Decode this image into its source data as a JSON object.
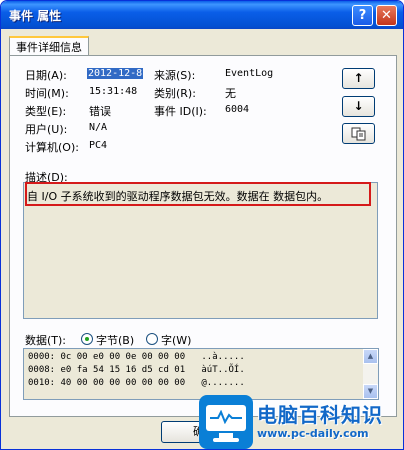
{
  "window": {
    "title": "事件 属性",
    "help_glyph": "?",
    "close_glyph": "✕"
  },
  "tabs": [
    {
      "label": "事件详细信息"
    }
  ],
  "fields": {
    "date_label": "日期(A):",
    "date_value": "2012-12-8",
    "source_label": "来源(S):",
    "source_value": "EventLog",
    "time_label": "时间(M):",
    "time_value": "15:31:48",
    "category_label": "类别(R):",
    "category_value": "无",
    "type_label": "类型(E):",
    "type_value": "错误",
    "event_id_label": "事件 ID(I):",
    "event_id_value": "6004",
    "user_label": "用户(U):",
    "user_value": "N/A",
    "computer_label": "计算机(O):",
    "computer_value": "PC4"
  },
  "nav": {
    "up_glyph": "↑",
    "down_glyph": "↓",
    "copy_icon": "copy-icon"
  },
  "description": {
    "label": "描述(D):",
    "text": "自 I/O 子系统收到的驱动程序数据包无效。数据在 数据包内。"
  },
  "data": {
    "label": "数据(T):",
    "bytes_label": "字节(B)",
    "words_label": "字(W)",
    "selected": "bytes",
    "rows": [
      "0000: 0c 00 e0 00 0e 00 00 00   ..à.....",
      "0008: e0 fa 54 15 16 d5 cd 01   àúT..ÕÍ.",
      "0010: 40 00 00 00 00 00 00 00   @......."
    ]
  },
  "buttons": {
    "ok_label": "确"
  },
  "watermark": {
    "title": "电脑百科知识",
    "url": "www.pc-daily.com"
  },
  "colors": {
    "highlight_border": "#d51a1a",
    "selection": "#316ac5",
    "watermark": "#1268c8"
  }
}
